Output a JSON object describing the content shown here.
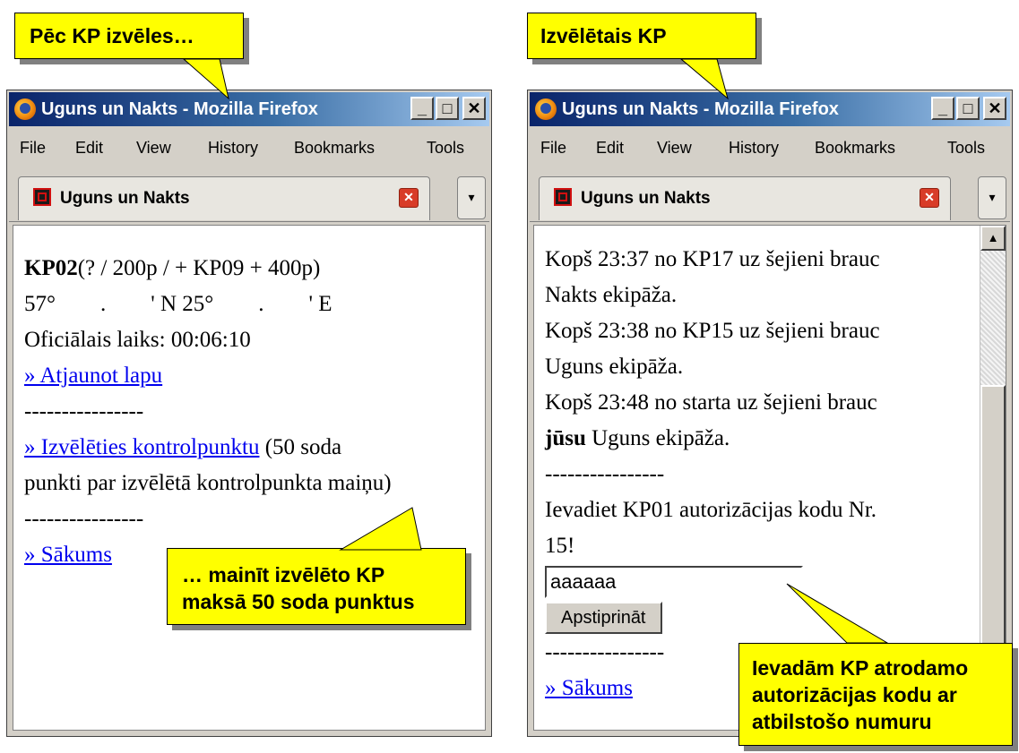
{
  "callouts": {
    "top_left": "Pēc KP izvēles…",
    "top_right": "Izvēlētais KP",
    "bottom_left": [
      "… mainīt izvēlēto KP",
      "maksā 50 soda punktus"
    ],
    "bottom_right": [
      "Ievadām KP atrodamo",
      "autorizācijas kodu ar",
      "atbilstošo numuru"
    ]
  },
  "browser": {
    "title": "Uguns un Nakts - Mozilla Firefox",
    "menu": [
      "File",
      "Edit",
      "View",
      "History",
      "Bookmarks",
      "Tools"
    ],
    "tab_title": "Uguns un Nakts",
    "window_buttons": {
      "minimize": "_",
      "maximize": "□",
      "close": "✕"
    },
    "tab_close": "✕",
    "tab_list": "▾"
  },
  "left_page": {
    "kp": "KP02",
    "kp_detail": "(? / 200p / + KP09 + 400p)",
    "coords": "57°        .        ' N 25°        .        ' E",
    "official_time": "Oficiālais laiks: 00:06:10",
    "refresh_link": "» Atjaunot lapu",
    "separator": "----------------",
    "choose_link": "» Izvēlēties kontrolpunktu",
    "choose_note_1": " (50 soda",
    "choose_note_2": "punkti par izvēlētā kontrolpunkta maiņu)",
    "home_link": "» Sākums"
  },
  "right_page": {
    "separator": "----------------",
    "line1": "Kopš 23:37 no KP17 uz šejieni brauc",
    "line2": "Nakts ekipāža.",
    "line3": "Kopš 23:38 no KP15 uz šejieni brauc",
    "line4": "Uguns ekipāža.",
    "line5": "Kopš 23:48 no starta uz šejieni brauc",
    "your_bold": "jūsu",
    "line6_rest": " Uguns ekipāža.",
    "prompt1": "Ievadiet KP01 autorizācijas kodu Nr.",
    "prompt2": "15!",
    "code_value": "aaaaaa",
    "confirm_button": "Apstiprināt",
    "home_link": "» Sākums"
  },
  "icons": [
    "firefox-icon",
    "site-favicon",
    "scroll-up-arrow-icon"
  ]
}
